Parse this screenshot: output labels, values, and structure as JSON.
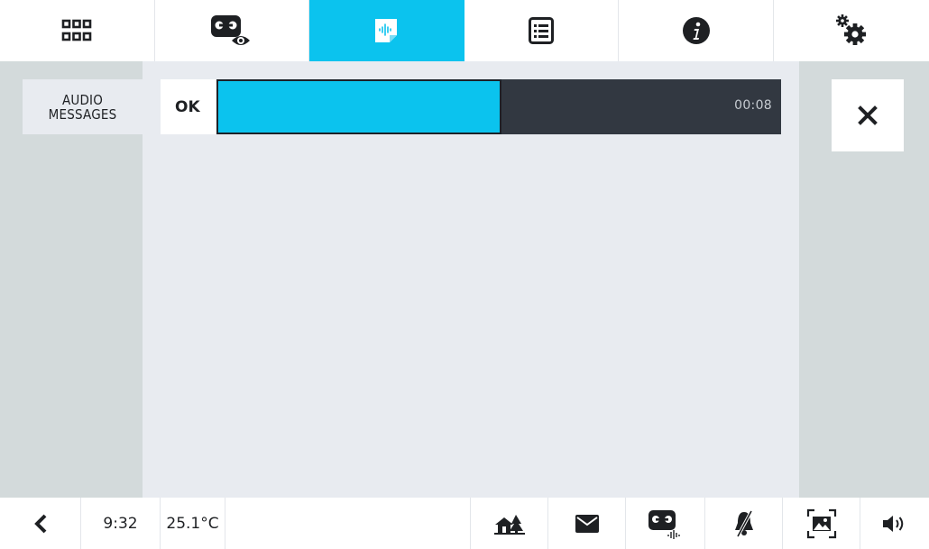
{
  "top_tabs": [
    {
      "icon": "apps-grid-icon"
    },
    {
      "icon": "voicemail-view-icon"
    },
    {
      "icon": "audio-message-icon",
      "active": true
    },
    {
      "icon": "list-icon"
    },
    {
      "icon": "info-icon"
    },
    {
      "icon": "settings-icon"
    }
  ],
  "panel": {
    "title_line1": "AUDIO",
    "title_line2": "MESSAGES"
  },
  "recorder": {
    "ok_label": "OK",
    "progress_fraction": 0.505,
    "time": "00:08"
  },
  "close": {
    "icon": "close-icon"
  },
  "status": {
    "time": "9:32",
    "temperature": "25.1°C"
  },
  "bottom_icons": [
    "home-icon",
    "mail-icon",
    "voicemail-audio-icon",
    "bell-muted-icon",
    "picture-frame-icon",
    "volume-icon"
  ],
  "colors": {
    "accent": "#0bc3ee",
    "dark": "#323841",
    "side": "#d3dadb",
    "bg": "#e8ebf0"
  }
}
